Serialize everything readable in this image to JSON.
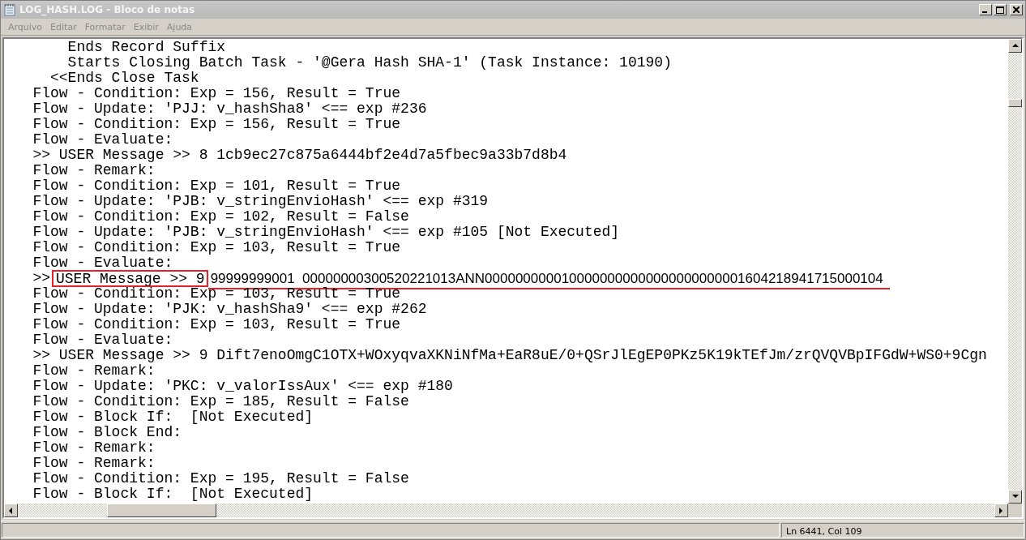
{
  "window": {
    "title": "LOG_HASH.LOG - Bloco de notas"
  },
  "menu": [
    "Arquivo",
    "Editar",
    "Formatar",
    "Exibir",
    "Ajuda"
  ],
  "lines": [
    {
      "kind": "plain",
      "text": "       Ends Record Suffix"
    },
    {
      "kind": "plain",
      "text": "       Starts Closing Batch Task - '@Gera Hash SHA-1' (Task Instance: 10190)"
    },
    {
      "kind": "plain",
      "text": "     <<Ends Close Task"
    },
    {
      "kind": "plain",
      "text": "   Flow - Condition: Exp = 156, Result = True"
    },
    {
      "kind": "plain",
      "text": "   Flow - Update: 'PJJ: v_hashSha8' <== exp #236"
    },
    {
      "kind": "plain",
      "text": "   Flow - Condition: Exp = 156, Result = True"
    },
    {
      "kind": "plain",
      "text": "   Flow - Evaluate:"
    },
    {
      "kind": "plain",
      "text": "   >> USER Message >> 8 1cb9ec27c875a6444bf2e4d7a5fbec9a33b7d8b4"
    },
    {
      "kind": "plain",
      "text": "   Flow - Remark:"
    },
    {
      "kind": "plain",
      "text": "   Flow - Condition: Exp = 101, Result = True"
    },
    {
      "kind": "plain",
      "text": "   Flow - Update: 'PJB: v_stringEnvioHash' <== exp #319"
    },
    {
      "kind": "plain",
      "text": "   Flow - Condition: Exp = 102, Result = False"
    },
    {
      "kind": "plain",
      "text": "   Flow - Update: 'PJB: v_stringEnvioHash' <== exp #105 [Not Executed]"
    },
    {
      "kind": "plain",
      "text": "   Flow - Condition: Exp = 103, Result = True"
    },
    {
      "kind": "plain",
      "text": "   Flow - Evaluate:"
    },
    {
      "kind": "marked",
      "prefix": "   >>",
      "boxed": "USER Message >> 9",
      "underlined": "99999999001  00000000300520221013ANN0000000000100000000000000000000001604218941715000104"
    },
    {
      "kind": "plain",
      "text": "   Flow - Condition: Exp = 103, Result = True"
    },
    {
      "kind": "plain",
      "text": "   Flow - Update: 'PJK: v_hashSha9' <== exp #262"
    },
    {
      "kind": "plain",
      "text": "   Flow - Condition: Exp = 103, Result = True"
    },
    {
      "kind": "plain",
      "text": "   Flow - Evaluate:"
    },
    {
      "kind": "plain",
      "text": "   >> USER Message >> 9 Dift7enoOmgC1OTX+WOxyqvaXKNiNfMa+EaR8uE/0+QSrJlEgEP0PKz5K19kTEfJm/zrQVQVBpIFGdW+WS0+9Cgn"
    },
    {
      "kind": "plain",
      "text": "   Flow - Remark:"
    },
    {
      "kind": "plain",
      "text": "   Flow - Update: 'PKC: v_valorIssAux' <== exp #180"
    },
    {
      "kind": "plain",
      "text": "   Flow - Condition: Exp = 185, Result = False"
    },
    {
      "kind": "plain",
      "text": "   Flow - Block If:  [Not Executed]"
    },
    {
      "kind": "plain",
      "text": "   Flow - Block End:"
    },
    {
      "kind": "plain",
      "text": "   Flow - Remark:"
    },
    {
      "kind": "plain",
      "text": "   Flow - Remark:"
    },
    {
      "kind": "plain",
      "text": "   Flow - Condition: Exp = 195, Result = False"
    },
    {
      "kind": "plain",
      "text": "   Flow - Block If:  [Not Executed]"
    }
  ],
  "status_bar": {
    "position": "Ln 6441, Col 109"
  }
}
